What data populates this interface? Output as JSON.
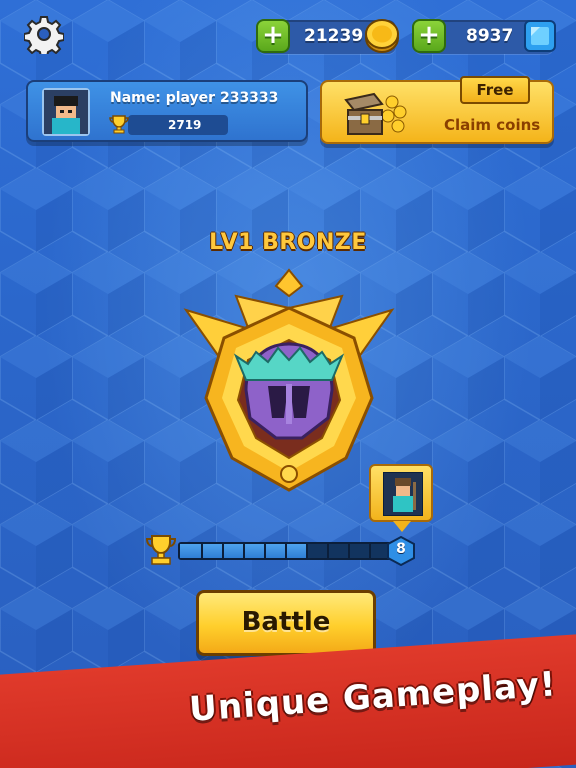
{
  "topbar": {
    "coins": "21239",
    "gems": "8937",
    "icons": {
      "settings": "gear-icon",
      "add": "plus-icon",
      "coin": "gold-coin-icon",
      "gem": "blue-gem-icon"
    }
  },
  "player": {
    "name": "Name: player 233333",
    "trophies": "2719",
    "avatar": "pixel-character-avatar"
  },
  "claim": {
    "tag": "Free",
    "label": "Claim coins",
    "icon": "treasure-chest-icon"
  },
  "rank": {
    "title": "LV1 BRONZE",
    "badge": "gold-helmet-rank-badge"
  },
  "progress": {
    "fill_fraction": 0.6,
    "segments": 10,
    "reward_level": "8",
    "reward": "pixel-character-reward"
  },
  "actions": {
    "battle_label": "Battle"
  },
  "banner": {
    "text": "Unique Gameplay!"
  },
  "colors": {
    "background": "#2b67cb",
    "gold": "#ffcf2c",
    "banner": "#d8302a",
    "green": "#6cbe2a"
  }
}
